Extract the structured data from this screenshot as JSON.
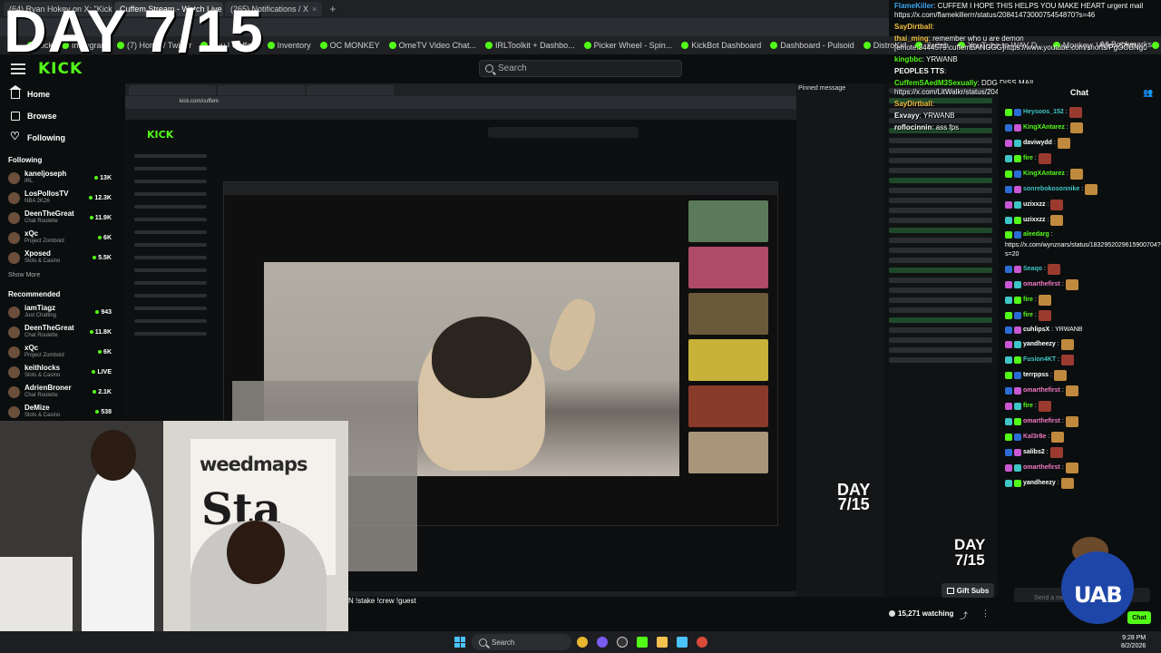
{
  "overlay": {
    "day_title": "DAY 7/15",
    "day_small_line1": "DAY",
    "day_small_line2": "7/15",
    "inner_day_line1": "DAY",
    "inner_day_line2": "7/15"
  },
  "browser": {
    "tabs": [
      {
        "label": "(64) Ryan Hokey on X: \"Kick\"",
        "active": false
      },
      {
        "label": "Cuffem Stream - Watch Live",
        "active": true
      },
      {
        "label": "(265) Notifications / X",
        "active": false
      }
    ],
    "bookmarks": [
      "Kick",
      "Instagram",
      "(7) Home / Twitter",
      "Bau | Cuffem",
      "Inventory",
      "OC MONKEY",
      "OmeTV Video Chat...",
      "IRLToolkit + Dashbo...",
      "Picker Wheel - Spin...",
      "KickBot Dashboard",
      "Dashboard - Pulsoid",
      "DistroKid",
      "Twitch",
      "YouTube to WAV D...",
      "Monkey: Video Chat...",
      "Home - Rob..."
    ],
    "all_bookmarks": "All Bookmarks"
  },
  "header": {
    "logo": "KICK",
    "search_placeholder": "Search"
  },
  "sidebar": {
    "nav": [
      {
        "label": "Home",
        "icon": "home-icon"
      },
      {
        "label": "Browse",
        "icon": "browse-icon"
      },
      {
        "label": "Following",
        "icon": "heart-icon"
      }
    ],
    "following_title": "Following",
    "following": [
      {
        "name": "kaneljoseph",
        "category": "IRL",
        "count": "13K"
      },
      {
        "name": "LosPollosTV",
        "category": "NBA 2K26",
        "count": "12.3K"
      },
      {
        "name": "DeenTheGreat",
        "category": "Chat Roulette",
        "count": "11.9K"
      },
      {
        "name": "xQc",
        "category": "Project Zomboid",
        "count": "6K"
      },
      {
        "name": "Xposed",
        "category": "Slots & Casino",
        "count": "5.5K"
      }
    ],
    "show_more": "Show More",
    "recommended_title": "Recommended",
    "recommended": [
      {
        "name": "iamTiagz",
        "category": "Just Chatting",
        "count": "943"
      },
      {
        "name": "DeenTheGreat",
        "category": "Chat Roulette",
        "count": "11.8K"
      },
      {
        "name": "xQc",
        "category": "Project Zomboid",
        "count": "6K"
      },
      {
        "name": "keithlocks",
        "category": "Slots & Casino",
        "count": "LIVE"
      },
      {
        "name": "AdrienBroner",
        "category": "Chat Roulette",
        "count": "2.1K"
      },
      {
        "name": "DeMize",
        "category": "Slots & Casino",
        "count": "538"
      }
    ]
  },
  "stream": {
    "inner_url": "kick.com/cuffem",
    "inner_logo": "KICK",
    "weedmaps": "weedmaps",
    "sta_text": "Sta",
    "stake_text": "N !stake !crew !guest",
    "pinned": "Pinned message"
  },
  "top_chat": [
    {
      "name": "FlameKiller",
      "color": "#3fa9f5",
      "text": "CUFFEM I HOPE THIS HELPS YOU MAKE HEART urgent mail https://x.com/flamekillerrr/status/2084147300075454870?s=46"
    },
    {
      "name": "SayDirtball",
      "color": "#f5c542",
      "text": ""
    },
    {
      "name": "thai_ming",
      "color": "#f5c542",
      "text": "remember who u are demon [emote:3444579:cuffemBANGGG]https://www.youtube.com/shorts/PgOOBNg0"
    },
    {
      "name": "kingbbc",
      "color": "#53fc18",
      "text": "YRWANB"
    },
    {
      "name": "PEOPLES TTS",
      "color": "#ffffff",
      "text": ""
    },
    {
      "name": "CuffemSAedM3Sexually",
      "color": "#53fc18",
      "text": "DDG DISS MAIL https://x.com/LitWalkr/status/2048737004209176757 @CUFFEM !"
    },
    {
      "name": "SayDirtball",
      "color": "#f5c542",
      "text": ""
    },
    {
      "name": "Exvayy",
      "color": "#ffffff",
      "text": "YRWANB"
    },
    {
      "name": "roflocinnin",
      "color": "#ffffff",
      "text": "ass fps"
    }
  ],
  "right_chat": {
    "title": "Chat",
    "messages": [
      {
        "name": "Heysoos_152",
        "color": "#3fc5c5",
        "text": ""
      },
      {
        "name": "KingXAntarez",
        "color": "#53fc18",
        "text": ""
      },
      {
        "name": "daviwydd",
        "color": "#ffffff",
        "text": ""
      },
      {
        "name": "fire",
        "color": "#53fc18",
        "text": ""
      },
      {
        "name": "KingXAntarez",
        "color": "#53fc18",
        "text": ""
      },
      {
        "name": "sonrebokosonnike",
        "color": "#3fc5c5",
        "text": ""
      },
      {
        "name": "uzixxzz",
        "color": "#ffffff",
        "text": ""
      },
      {
        "name": "uzixxzz",
        "color": "#ffffff",
        "text": ""
      },
      {
        "name": "aleedarg",
        "color": "#53fc18",
        "text": "https://x.com/wynznars/status/1832952029615900704?s=20"
      },
      {
        "name": "Seaqo",
        "color": "#3fc5c5",
        "text": ""
      },
      {
        "name": "omarthefirst",
        "color": "#f57ac5",
        "text": ""
      },
      {
        "name": "fire",
        "color": "#53fc18",
        "text": ""
      },
      {
        "name": "fire",
        "color": "#53fc18",
        "text": ""
      },
      {
        "name": "cuhlipsX",
        "color": "#ffffff",
        "text": "YRWANB"
      },
      {
        "name": "yandheezy",
        "color": "#ffffff",
        "text": ""
      },
      {
        "name": "Fusion4KT",
        "color": "#3fc5c5",
        "text": ""
      },
      {
        "name": "terrppss",
        "color": "#ffffff",
        "text": ""
      },
      {
        "name": "omarthefirst",
        "color": "#f57ac5",
        "text": ""
      },
      {
        "name": "fire",
        "color": "#53fc18",
        "text": ""
      },
      {
        "name": "omarthefirst",
        "color": "#f57ac5",
        "text": ""
      },
      {
        "name": "Kal3r8e",
        "color": "#f57ac5",
        "text": ""
      },
      {
        "name": "salibs2",
        "color": "#ffffff",
        "text": ""
      },
      {
        "name": "omarthefirst",
        "color": "#f57ac5",
        "text": ""
      },
      {
        "name": "yandheezy",
        "color": "#ffffff",
        "text": ""
      }
    ],
    "input_placeholder": "Send a message",
    "send_label": "Chat",
    "mascot_letters": "UAB"
  },
  "stream_footer": {
    "gift_label": "Gift Subs",
    "watching": "15,271 watching"
  },
  "taskbar": {
    "search_label": "Search",
    "time": "9:28 PM",
    "date": "8/2/2026"
  }
}
